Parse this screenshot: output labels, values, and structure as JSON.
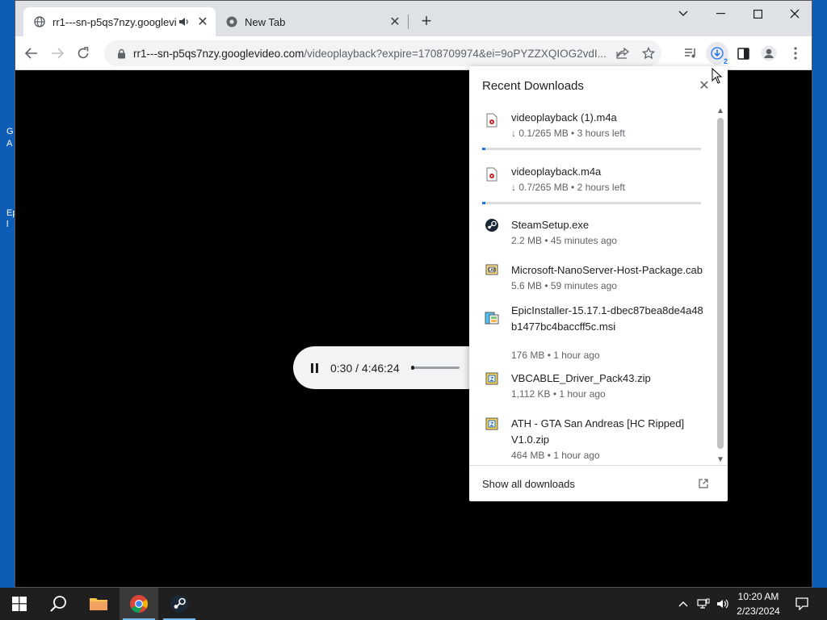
{
  "desktop": {
    "fragments": [
      "G",
      "A",
      "Ep",
      "l"
    ]
  },
  "browser": {
    "tabs": [
      {
        "title": "rr1---sn-p5qs7nzy.googlevid",
        "icon": "globe-icon",
        "audio": true,
        "active": true
      },
      {
        "title": "New Tab",
        "icon": "chrome-icon",
        "active": false
      }
    ],
    "url_host": "rr1---sn-p5qs7nzy.googlevideo.com",
    "url_path": "/videoplayback?expire=1708709974&ei=9oPYZZXQIOG2vdI...",
    "download_badge": "2"
  },
  "player": {
    "current_time": "0:30",
    "separator": " / ",
    "duration": "4:46:24",
    "progress_fraction": 0.0017
  },
  "downloads": {
    "title": "Recent Downloads",
    "footer_link": "Show all downloads",
    "items": [
      {
        "name": "videoplayback (1).m4a",
        "status": "↓ 0.1/265 MB • 3 hours left",
        "icon": "audio-file-icon",
        "in_progress": true,
        "progress": 0.0004
      },
      {
        "name": "videoplayback.m4a",
        "status": "↓ 0.7/265 MB • 2 hours left",
        "icon": "audio-file-icon",
        "in_progress": true,
        "progress": 0.003
      },
      {
        "name": "SteamSetup.exe",
        "status": "2.2 MB • 45 minutes ago",
        "icon": "steam-icon",
        "in_progress": false
      },
      {
        "name": "Microsoft-NanoServer-Host-Package.cab",
        "status": "5.6 MB • 59 minutes ago",
        "icon": "cab-file-icon",
        "in_progress": false
      },
      {
        "name": "EpicInstaller-15.17.1-dbec87bea8de4a48b1477bc4baccff5c.msi",
        "status": "176 MB • 1 hour ago",
        "icon": "msi-file-icon",
        "in_progress": false
      },
      {
        "name": "VBCABLE_Driver_Pack43.zip",
        "status": "1,112 KB • 1 hour ago",
        "icon": "zip-file-icon",
        "in_progress": false
      },
      {
        "name": "ATH - GTA San Andreas [HC Ripped] V1.0.zip",
        "status": "464 MB • 1 hour ago",
        "icon": "zip-file-icon",
        "in_progress": false
      }
    ]
  },
  "taskbar": {
    "time": "10:20 AM",
    "date": "2/23/2024"
  },
  "colors": {
    "accent": "#1a73e8",
    "desktop": "#0d5cb6",
    "taskbar": "#1f1f1f"
  }
}
